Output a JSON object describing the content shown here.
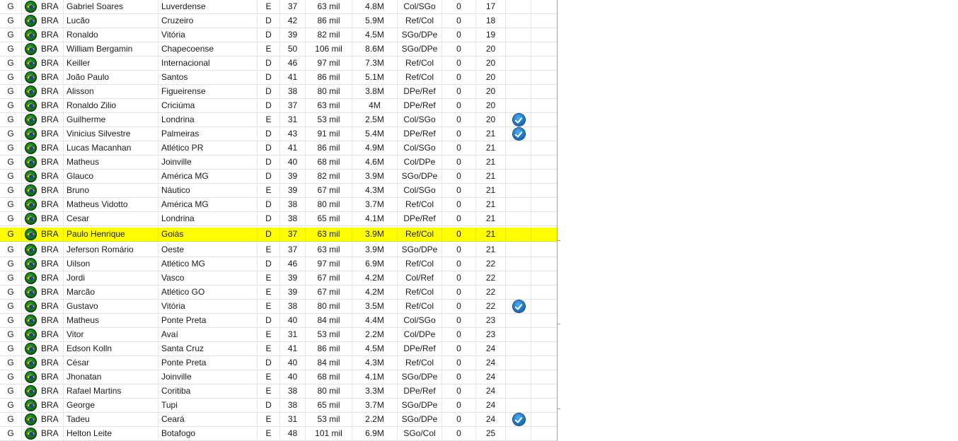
{
  "players": [
    {
      "pos": "G",
      "nat": "BRA",
      "name": "Gabriel Soares",
      "club": "Luverdense",
      "side": "E",
      "age": "37",
      "salary": "63 mil",
      "value": "4.8M",
      "skill": "Col/SGo",
      "zero": "0",
      "num": "17",
      "check": false
    },
    {
      "pos": "G",
      "nat": "BRA",
      "name": "Lucão",
      "club": "Cruzeiro",
      "side": "D",
      "age": "42",
      "salary": "86 mil",
      "value": "5.9M",
      "skill": "Ref/Col",
      "zero": "0",
      "num": "18",
      "check": false
    },
    {
      "pos": "G",
      "nat": "BRA",
      "name": "Ronaldo",
      "club": "Vitória",
      "side": "D",
      "age": "39",
      "salary": "82 mil",
      "value": "4.5M",
      "skill": "SGo/DPe",
      "zero": "0",
      "num": "19",
      "check": false
    },
    {
      "pos": "G",
      "nat": "BRA",
      "name": "William Bergamin",
      "club": "Chapecoense",
      "side": "E",
      "age": "50",
      "salary": "106 mil",
      "value": "8.6M",
      "skill": "SGo/DPe",
      "zero": "0",
      "num": "20",
      "check": false
    },
    {
      "pos": "G",
      "nat": "BRA",
      "name": "Keiller",
      "club": "Internacional",
      "side": "D",
      "age": "46",
      "salary": "97 mil",
      "value": "7.3M",
      "skill": "Ref/Col",
      "zero": "0",
      "num": "20",
      "check": false
    },
    {
      "pos": "G",
      "nat": "BRA",
      "name": "João Paulo",
      "club": "Santos",
      "side": "D",
      "age": "41",
      "salary": "86 mil",
      "value": "5.1M",
      "skill": "Ref/Col",
      "zero": "0",
      "num": "20",
      "check": false
    },
    {
      "pos": "G",
      "nat": "BRA",
      "name": "Alisson",
      "club": "Figueirense",
      "side": "D",
      "age": "38",
      "salary": "80 mil",
      "value": "3.8M",
      "skill": "DPe/Ref",
      "zero": "0",
      "num": "20",
      "check": false
    },
    {
      "pos": "G",
      "nat": "BRA",
      "name": "Ronaldo Zilio",
      "club": "Criciúma",
      "side": "D",
      "age": "37",
      "salary": "63 mil",
      "value": "4M",
      "skill": "DPe/Ref",
      "zero": "0",
      "num": "20",
      "check": false
    },
    {
      "pos": "G",
      "nat": "BRA",
      "name": "Guilherme",
      "club": "Londrina",
      "side": "E",
      "age": "31",
      "salary": "53 mil",
      "value": "2.5M",
      "skill": "Col/SGo",
      "zero": "0",
      "num": "20",
      "check": true
    },
    {
      "pos": "G",
      "nat": "BRA",
      "name": "Vinicius Silvestre",
      "club": "Palmeiras",
      "side": "D",
      "age": "43",
      "salary": "91 mil",
      "value": "5.4M",
      "skill": "DPe/Ref",
      "zero": "0",
      "num": "21",
      "check": true
    },
    {
      "pos": "G",
      "nat": "BRA",
      "name": "Lucas Macanhan",
      "club": "Atlético PR",
      "side": "D",
      "age": "41",
      "salary": "86 mil",
      "value": "4.9M",
      "skill": "Col/SGo",
      "zero": "0",
      "num": "21",
      "check": false
    },
    {
      "pos": "G",
      "nat": "BRA",
      "name": "Matheus",
      "club": "Joinville",
      "side": "D",
      "age": "40",
      "salary": "68 mil",
      "value": "4.6M",
      "skill": "Col/DPe",
      "zero": "0",
      "num": "21",
      "check": false
    },
    {
      "pos": "G",
      "nat": "BRA",
      "name": "Glauco",
      "club": "América MG",
      "side": "D",
      "age": "39",
      "salary": "82 mil",
      "value": "3.9M",
      "skill": "SGo/DPe",
      "zero": "0",
      "num": "21",
      "check": false
    },
    {
      "pos": "G",
      "nat": "BRA",
      "name": "Bruno",
      "club": "Náutico",
      "side": "E",
      "age": "39",
      "salary": "67 mil",
      "value": "4.3M",
      "skill": "Col/SGo",
      "zero": "0",
      "num": "21",
      "check": false
    },
    {
      "pos": "G",
      "nat": "BRA",
      "name": "Matheus Vidotto",
      "club": "América MG",
      "side": "D",
      "age": "38",
      "salary": "80 mil",
      "value": "3.7M",
      "skill": "Ref/Col",
      "zero": "0",
      "num": "21",
      "check": false
    },
    {
      "pos": "G",
      "nat": "BRA",
      "name": "Cesar",
      "club": "Londrina",
      "side": "D",
      "age": "38",
      "salary": "65 mil",
      "value": "4.1M",
      "skill": "DPe/Ref",
      "zero": "0",
      "num": "21",
      "check": false
    },
    {
      "pos": "G",
      "nat": "BRA",
      "name": "Paulo Henrique",
      "club": "Goiás",
      "side": "D",
      "age": "37",
      "salary": "63 mil",
      "value": "3.9M",
      "skill": "Ref/Col",
      "zero": "0",
      "num": "21",
      "check": false,
      "selected": true
    },
    {
      "pos": "G",
      "nat": "BRA",
      "name": "Jeferson Romário",
      "club": "Oeste",
      "side": "E",
      "age": "37",
      "salary": "63 mil",
      "value": "3.9M",
      "skill": "SGo/DPe",
      "zero": "0",
      "num": "21",
      "check": false
    },
    {
      "pos": "G",
      "nat": "BRA",
      "name": "Uilson",
      "club": "Atlético MG",
      "side": "D",
      "age": "46",
      "salary": "97 mil",
      "value": "6.9M",
      "skill": "Ref/Col",
      "zero": "0",
      "num": "22",
      "check": false
    },
    {
      "pos": "G",
      "nat": "BRA",
      "name": "Jordi",
      "club": "Vasco",
      "side": "E",
      "age": "39",
      "salary": "67 mil",
      "value": "4.2M",
      "skill": "Col/Ref",
      "zero": "0",
      "num": "22",
      "check": false
    },
    {
      "pos": "G",
      "nat": "BRA",
      "name": "Marcão",
      "club": "Atlético GO",
      "side": "E",
      "age": "39",
      "salary": "67 mil",
      "value": "4.2M",
      "skill": "Ref/Col",
      "zero": "0",
      "num": "22",
      "check": false
    },
    {
      "pos": "G",
      "nat": "BRA",
      "name": "Gustavo",
      "club": "Vitória",
      "side": "E",
      "age": "38",
      "salary": "80 mil",
      "value": "3.5M",
      "skill": "Ref/Col",
      "zero": "0",
      "num": "22",
      "check": true
    },
    {
      "pos": "G",
      "nat": "BRA",
      "name": "Matheus",
      "club": "Ponte Preta",
      "side": "D",
      "age": "40",
      "salary": "84 mil",
      "value": "4.4M",
      "skill": "Col/SGo",
      "zero": "0",
      "num": "23",
      "check": false
    },
    {
      "pos": "G",
      "nat": "BRA",
      "name": "Vitor",
      "club": "Avaí",
      "side": "E",
      "age": "31",
      "salary": "53 mil",
      "value": "2.2M",
      "skill": "Col/DPe",
      "zero": "0",
      "num": "23",
      "check": false
    },
    {
      "pos": "G",
      "nat": "BRA",
      "name": "Edson Kolln",
      "club": "Santa Cruz",
      "side": "E",
      "age": "41",
      "salary": "86 mil",
      "value": "4.5M",
      "skill": "DPe/Ref",
      "zero": "0",
      "num": "24",
      "check": false
    },
    {
      "pos": "G",
      "nat": "BRA",
      "name": "César",
      "club": "Ponte Preta",
      "side": "D",
      "age": "40",
      "salary": "84 mil",
      "value": "4.3M",
      "skill": "Ref/Col",
      "zero": "0",
      "num": "24",
      "check": false
    },
    {
      "pos": "G",
      "nat": "BRA",
      "name": "Jhonatan",
      "club": "Joinville",
      "side": "E",
      "age": "40",
      "salary": "68 mil",
      "value": "4.1M",
      "skill": "SGo/DPe",
      "zero": "0",
      "num": "24",
      "check": false
    },
    {
      "pos": "G",
      "nat": "BRA",
      "name": "Rafael Martins",
      "club": "Coritiba",
      "side": "E",
      "age": "38",
      "salary": "80 mil",
      "value": "3.3M",
      "skill": "DPe/Ref",
      "zero": "0",
      "num": "24",
      "check": false
    },
    {
      "pos": "G",
      "nat": "BRA",
      "name": "George",
      "club": "Tupi",
      "side": "D",
      "age": "38",
      "salary": "65 mil",
      "value": "3.7M",
      "skill": "SGo/DPe",
      "zero": "0",
      "num": "24",
      "check": false
    },
    {
      "pos": "G",
      "nat": "BRA",
      "name": "Tadeu",
      "club": "Ceará",
      "side": "E",
      "age": "31",
      "salary": "53 mil",
      "value": "2.2M",
      "skill": "SGo/DPe",
      "zero": "0",
      "num": "24",
      "check": true
    },
    {
      "pos": "G",
      "nat": "BRA",
      "name": "Helton Leite",
      "club": "Botafogo",
      "side": "E",
      "age": "48",
      "salary": "101 mil",
      "value": "6.9M",
      "skill": "SGo/Col",
      "zero": "0",
      "num": "25",
      "check": false
    }
  ],
  "colors": {
    "selected_row": "#ffff00",
    "flag_green": "#12701a",
    "flag_yellow": "#f3d000",
    "flag_blue": "#1d3f9a",
    "check_blue": "#1d6fbd"
  },
  "icons": {
    "flag": "brazil-flag-icon",
    "check": "checkmark-icon"
  }
}
